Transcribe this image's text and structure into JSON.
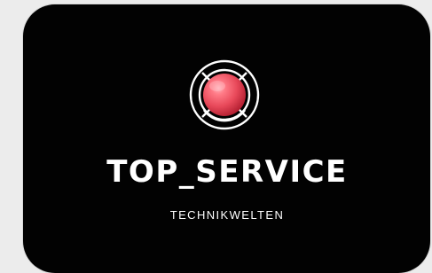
{
  "logo": {
    "icon": "lifebuoy-target-icon",
    "brand_name": "TOP_SERVICE",
    "tagline": "TECHNIKWELTEN",
    "colors": {
      "background": "#020202",
      "outline": "#ffffff",
      "accent": "#e8495a",
      "accent_shadow": "#b31f31",
      "accent_highlight": "#ff8b95"
    }
  }
}
